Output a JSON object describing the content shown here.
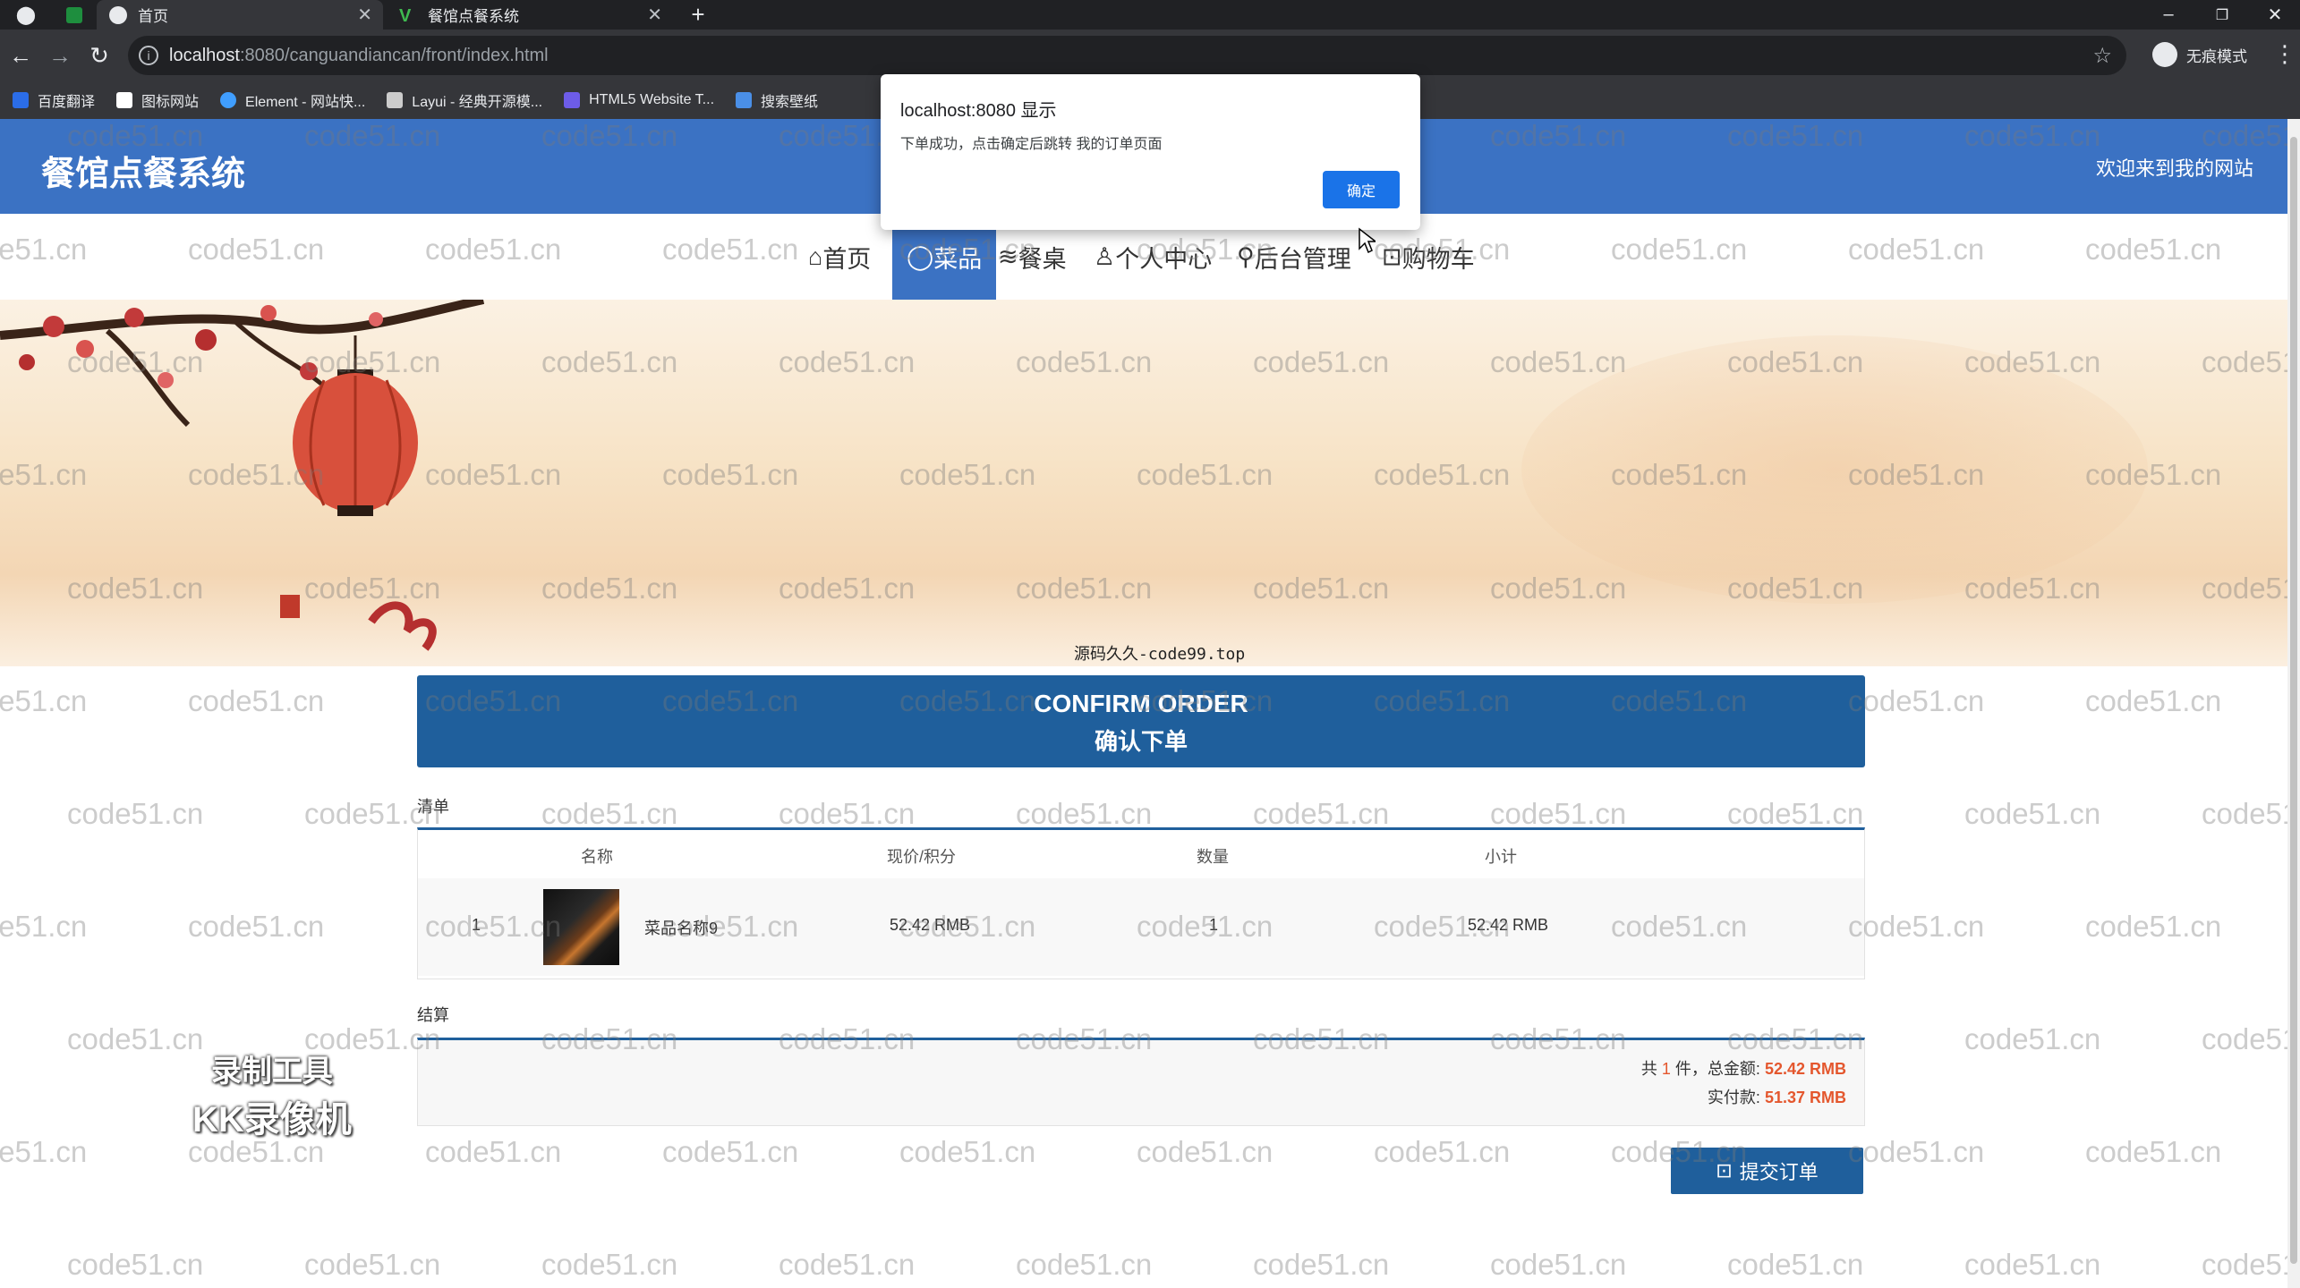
{
  "browser": {
    "tabs": [
      {
        "label": "首页",
        "active": true
      },
      {
        "label": "餐馆点餐系统",
        "active": false
      }
    ],
    "new_tab": "+",
    "url_host": "localhost",
    "url_rest": ":8080/canguandiancan/front/index.html",
    "incognito_label": "无痕模式",
    "bookmarks": [
      {
        "label": "百度翻译",
        "color": "#2b6de8"
      },
      {
        "label": "图标网站",
        "color": "#ffffff"
      },
      {
        "label": "Element - 网站快...",
        "color": "#409eff"
      },
      {
        "label": "Layui - 经典开源模...",
        "color": "#cccccc"
      },
      {
        "label": "HTML5 Website T...",
        "color": "#6d5ce8"
      },
      {
        "label": "搜索壁纸",
        "color": "#4a8fe7"
      }
    ]
  },
  "header": {
    "site_title": "餐馆点餐系统",
    "welcome": "欢迎来到我的网站"
  },
  "nav": {
    "items": [
      {
        "icon": "⌂",
        "label": "首页"
      },
      {
        "icon": "◯",
        "label": "菜品",
        "active": true
      },
      {
        "icon": "≋",
        "label": "餐桌"
      },
      {
        "icon": "♙",
        "label": "个人中心"
      },
      {
        "icon": "⚲",
        "label": "后台管理"
      },
      {
        "icon": "⊡",
        "label": "购物车"
      }
    ]
  },
  "banner_caption": "源码久久-code99.top",
  "confirm": {
    "title_en": "CONFIRM ORDER",
    "title_cn": "确认下单"
  },
  "list": {
    "label": "清单",
    "headers": [
      "名称",
      "现价/积分",
      "数量",
      "小计"
    ],
    "rows": [
      {
        "index": "1",
        "name": "菜品名称9",
        "price": "52.42 RMB",
        "qty": "1",
        "subtotal": "52.42 RMB"
      }
    ]
  },
  "settle": {
    "label": "结算",
    "line1_prefix": "共",
    "count": "1",
    "line1_mid": "件，总金额:",
    "total": "52.42 RMB",
    "line2_prefix": "实付款:",
    "paid": "51.37 RMB"
  },
  "submit_label": "提交订单",
  "watermark_text": "code51.cn",
  "recorder": {
    "line1": "录制工具",
    "line2": "KK录像机"
  },
  "dialog": {
    "title": "localhost:8080 显示",
    "message": "下单成功，点击确定后跳转 我的订单页面",
    "ok_label": "确定"
  },
  "colors": {
    "header_blue": "#3b72c3",
    "primary_blue": "#1f5f9c",
    "price_red": "#e4572e"
  }
}
